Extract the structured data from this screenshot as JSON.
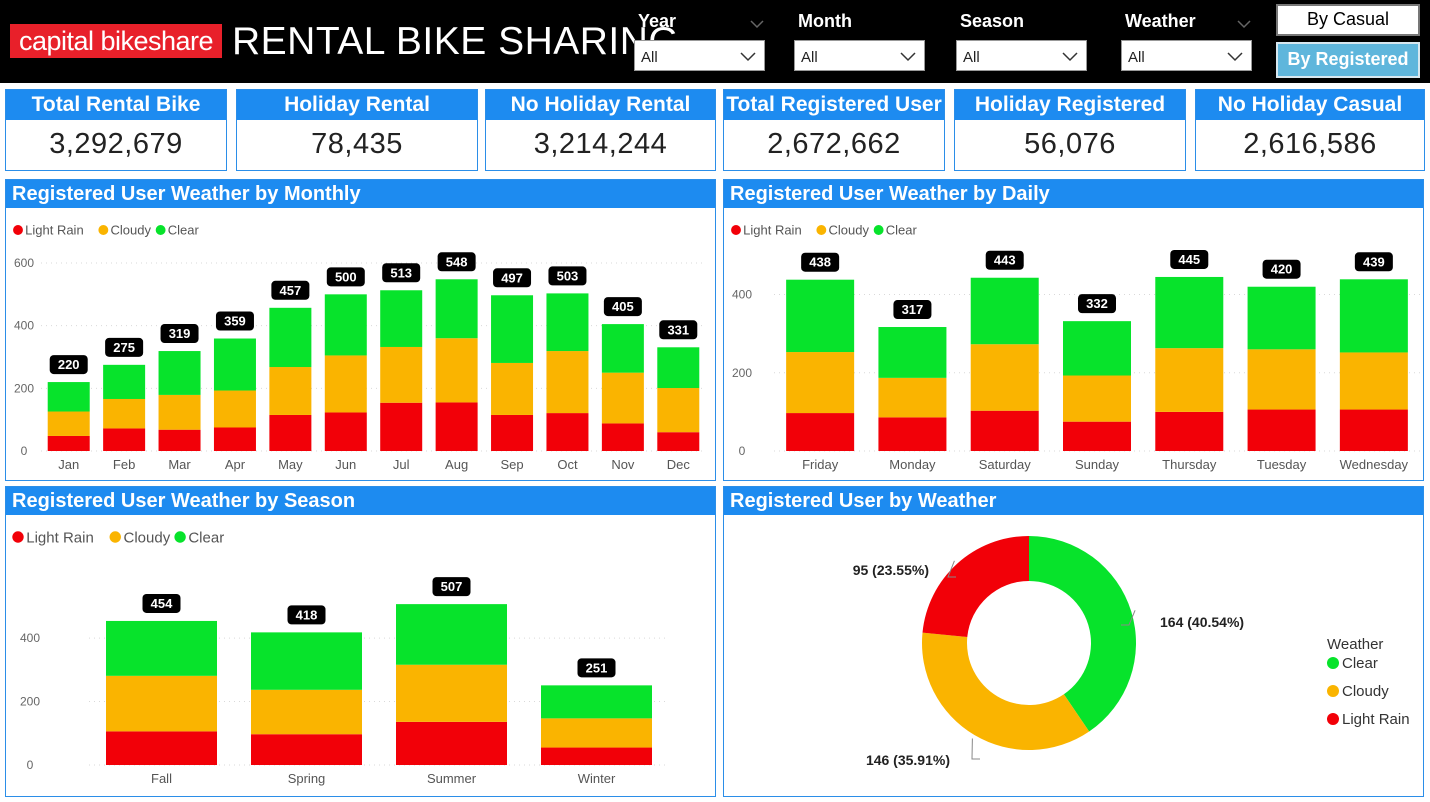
{
  "header": {
    "logo_text": "capital bikeshare",
    "title": "RENTAL BIKE SHARING",
    "filters": [
      {
        "label": "Year",
        "value": "All"
      },
      {
        "label": "Month",
        "value": "All"
      },
      {
        "label": "Season",
        "value": "All"
      },
      {
        "label": "Weather",
        "value": "All"
      }
    ],
    "buttons": {
      "casual": "By Casual",
      "registered": "By Registered"
    }
  },
  "kpis": [
    {
      "label": "Total Rental Bike",
      "value": "3,292,679"
    },
    {
      "label": "Holiday Rental",
      "value": "78,435"
    },
    {
      "label": "No Holiday Rental",
      "value": "3,214,244"
    },
    {
      "label": "Total Registered User",
      "value": "2,672,662"
    },
    {
      "label": "Holiday Registered",
      "value": "56,076"
    },
    {
      "label": "No Holiday Casual",
      "value": "2,616,586"
    }
  ],
  "colors": {
    "light_rain": "#f20008",
    "cloudy": "#fab400",
    "clear": "#07e32b",
    "accent": "#1d8bf0"
  },
  "legend": [
    "Light Rain",
    "Cloudy",
    "Clear"
  ],
  "chart_data": [
    {
      "type": "bar",
      "stacked": true,
      "title": "Registered User Weather by Monthly",
      "categories": [
        "Jan",
        "Feb",
        "Mar",
        "Apr",
        "May",
        "Jun",
        "Jul",
        "Aug",
        "Sep",
        "Oct",
        "Nov",
        "Dec"
      ],
      "series": [
        {
          "name": "Light Rain",
          "values": [
            48,
            72,
            68,
            75,
            115,
            123,
            154,
            155,
            115,
            121,
            88,
            60
          ]
        },
        {
          "name": "Cloudy",
          "values": [
            78,
            94,
            111,
            118,
            153,
            182,
            178,
            205,
            166,
            198,
            162,
            141
          ]
        },
        {
          "name": "Clear",
          "values": [
            94,
            109,
            140,
            166,
            189,
            195,
            181,
            188,
            216,
            184,
            155,
            130
          ]
        }
      ],
      "totals": [
        220,
        275,
        319,
        359,
        457,
        500,
        513,
        548,
        497,
        503,
        405,
        331
      ],
      "yticks": [
        0,
        200,
        400,
        600
      ],
      "ylim": [
        0,
        600
      ]
    },
    {
      "type": "bar",
      "stacked": true,
      "title": "Registered User Weather by Daily",
      "categories": [
        "Friday",
        "Monday",
        "Saturday",
        "Sunday",
        "Thursday",
        "Tuesday",
        "Wednesday"
      ],
      "series": [
        {
          "name": "Light Rain",
          "values": [
            97,
            86,
            103,
            75,
            100,
            106,
            106
          ]
        },
        {
          "name": "Cloudy",
          "values": [
            156,
            101,
            170,
            118,
            163,
            154,
            146
          ]
        },
        {
          "name": "Clear",
          "values": [
            185,
            130,
            170,
            139,
            182,
            160,
            187
          ]
        }
      ],
      "totals": [
        438,
        317,
        443,
        332,
        445,
        420,
        439
      ],
      "yticks": [
        0,
        200,
        400
      ],
      "ylim": [
        0,
        450
      ]
    },
    {
      "type": "bar",
      "stacked": true,
      "title": "Registered User Weather by Season",
      "categories": [
        "Fall",
        "Spring",
        "Summer",
        "Winter"
      ],
      "series": [
        {
          "name": "Light Rain",
          "values": [
            106,
            97,
            136,
            55
          ]
        },
        {
          "name": "Cloudy",
          "values": [
            175,
            140,
            180,
            92
          ]
        },
        {
          "name": "Clear",
          "values": [
            173,
            181,
            191,
            104
          ]
        }
      ],
      "totals": [
        454,
        418,
        507,
        251
      ],
      "yticks": [
        0,
        200,
        400
      ],
      "ylim": [
        0,
        520
      ]
    },
    {
      "type": "pie",
      "donut": true,
      "title": "Registered User by Weather",
      "legend_title": "Weather",
      "slices": [
        {
          "name": "Clear",
          "value": 164,
          "label": "164 (40.54%)"
        },
        {
          "name": "Cloudy",
          "value": 146,
          "label": "146 (35.91%)"
        },
        {
          "name": "Light Rain",
          "value": 95,
          "label": "95 (23.55%)"
        }
      ]
    }
  ]
}
